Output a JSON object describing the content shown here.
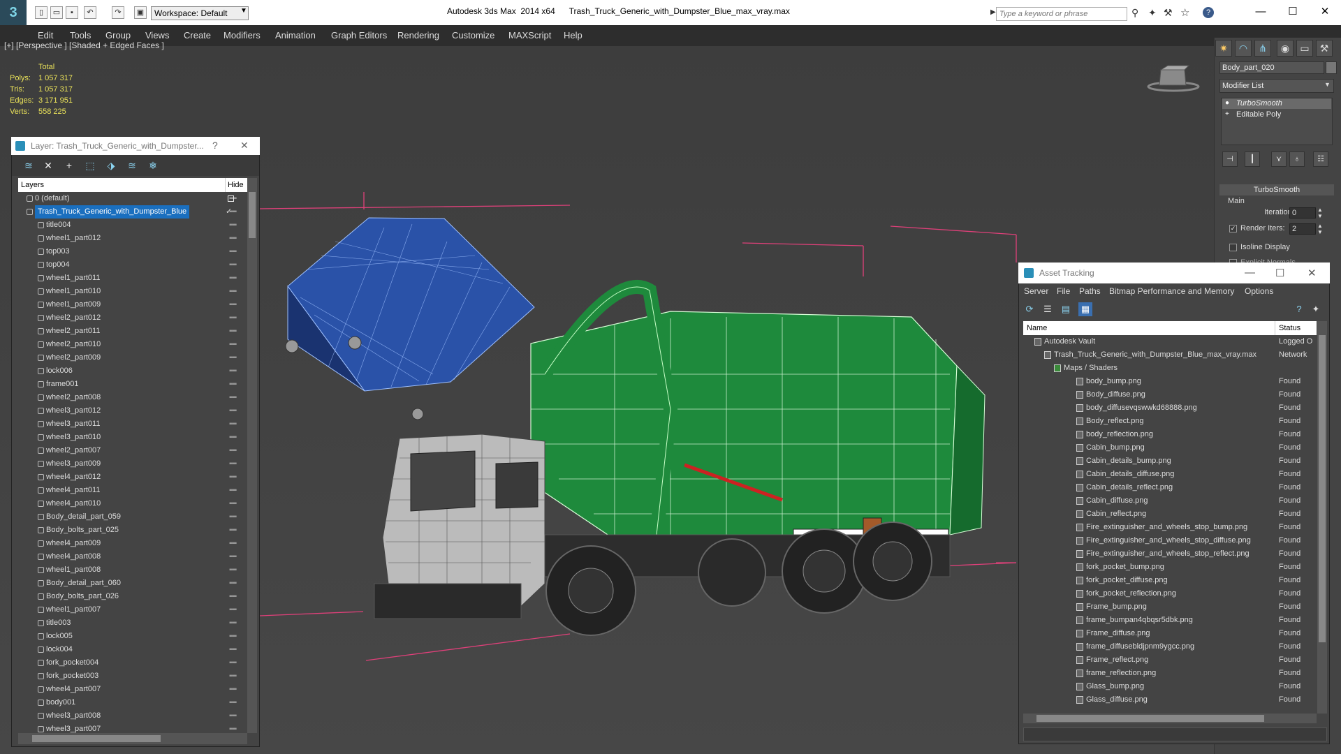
{
  "titlebar": {
    "app_title": "Autodesk 3ds Max  2014 x64",
    "file_name": "Trash_Truck_Generic_with_Dumpster_Blue_max_vray.max",
    "workspace": "Workspace: Default",
    "search_placeholder": "Type a keyword or phrase",
    "minimize": "—",
    "maximize": "☐",
    "close": "✕"
  },
  "menu": [
    "Edit",
    "Tools",
    "Group",
    "Views",
    "Create",
    "Modifiers",
    "Animation",
    "Graph Editors",
    "Rendering",
    "Customize",
    "MAXScript",
    "Help"
  ],
  "viewport": {
    "label": "[+] [Perspective ] [Shaded + Edged Faces ]",
    "stats": {
      "header": "Total",
      "rows": [
        {
          "label": "Polys:",
          "value": "1 057 317"
        },
        {
          "label": "Tris:",
          "value": "1 057 317"
        },
        {
          "label": "Edges:",
          "value": "3 171 951"
        },
        {
          "label": "Verts:",
          "value": "558 225"
        }
      ]
    }
  },
  "command_panel": {
    "object_name": "Body_part_020",
    "modifier_list": "Modifier List",
    "stack": [
      "TurboSmooth",
      "Editable Poly"
    ],
    "rollout_title": "TurboSmooth",
    "main_label": "Main",
    "iterations_label": "Iterations:",
    "iterations_value": "0",
    "render_iters_label": "Render Iters:",
    "render_iters_value": "2",
    "isoline_label": "Isoline Display",
    "explicit_label": "Explicit Normals"
  },
  "layer_explorer": {
    "title": "Layer: Trash_Truck_Generic_with_Dumpster...",
    "help": "?",
    "close": "✕",
    "col_layers": "Layers",
    "col_hide": "Hide",
    "rows": [
      {
        "name": "0 (default)",
        "level": 1,
        "selected": false
      },
      {
        "name": "Trash_Truck_Generic_with_Dumpster_Blue",
        "level": 1,
        "selected": true
      },
      {
        "name": "title004",
        "level": 2
      },
      {
        "name": "wheel1_part012",
        "level": 2
      },
      {
        "name": "top003",
        "level": 2
      },
      {
        "name": "top004",
        "level": 2
      },
      {
        "name": "wheel1_part011",
        "level": 2
      },
      {
        "name": "wheel1_part010",
        "level": 2
      },
      {
        "name": "wheel1_part009",
        "level": 2
      },
      {
        "name": "wheel2_part012",
        "level": 2
      },
      {
        "name": "wheel2_part011",
        "level": 2
      },
      {
        "name": "wheel2_part010",
        "level": 2
      },
      {
        "name": "wheel2_part009",
        "level": 2
      },
      {
        "name": "lock006",
        "level": 2
      },
      {
        "name": "frame001",
        "level": 2
      },
      {
        "name": "wheel2_part008",
        "level": 2
      },
      {
        "name": "wheel3_part012",
        "level": 2
      },
      {
        "name": "wheel3_part011",
        "level": 2
      },
      {
        "name": "wheel3_part010",
        "level": 2
      },
      {
        "name": "wheel2_part007",
        "level": 2
      },
      {
        "name": "wheel3_part009",
        "level": 2
      },
      {
        "name": "wheel4_part012",
        "level": 2
      },
      {
        "name": "wheel4_part011",
        "level": 2
      },
      {
        "name": "wheel4_part010",
        "level": 2
      },
      {
        "name": "Body_detail_part_059",
        "level": 2
      },
      {
        "name": "Body_bolts_part_025",
        "level": 2
      },
      {
        "name": "wheel4_part009",
        "level": 2
      },
      {
        "name": "wheel4_part008",
        "level": 2
      },
      {
        "name": "wheel1_part008",
        "level": 2
      },
      {
        "name": "Body_detail_part_060",
        "level": 2
      },
      {
        "name": "Body_bolts_part_026",
        "level": 2
      },
      {
        "name": "wheel1_part007",
        "level": 2
      },
      {
        "name": "title003",
        "level": 2
      },
      {
        "name": "lock005",
        "level": 2
      },
      {
        "name": "lock004",
        "level": 2
      },
      {
        "name": "fork_pocket004",
        "level": 2
      },
      {
        "name": "fork_pocket003",
        "level": 2
      },
      {
        "name": "wheel4_part007",
        "level": 2
      },
      {
        "name": "body001",
        "level": 2
      },
      {
        "name": "wheel3_part008",
        "level": 2
      },
      {
        "name": "wheel3_part007",
        "level": 2
      }
    ]
  },
  "asset_tracking": {
    "title": "Asset Tracking",
    "minimize": "—",
    "maximize": "☐",
    "close": "✕",
    "menu": [
      "Server",
      "File",
      "Paths",
      "Bitmap Performance and Memory",
      "Options"
    ],
    "col_name": "Name",
    "col_status": "Status",
    "rows": [
      {
        "name": "Autodesk Vault",
        "status": "Logged O",
        "level": 0
      },
      {
        "name": "Trash_Truck_Generic_with_Dumpster_Blue_max_vray.max",
        "status": "Network",
        "level": 1
      },
      {
        "name": "Maps / Shaders",
        "status": "",
        "level": 2
      },
      {
        "name": "body_bump.png",
        "status": "Found",
        "level": 3
      },
      {
        "name": "Body_diffuse.png",
        "status": "Found",
        "level": 3
      },
      {
        "name": "body_diffusevqswwkd68888.png",
        "status": "Found",
        "level": 3
      },
      {
        "name": "Body_reflect.png",
        "status": "Found",
        "level": 3
      },
      {
        "name": "body_reflection.png",
        "status": "Found",
        "level": 3
      },
      {
        "name": "Cabin_bump.png",
        "status": "Found",
        "level": 3
      },
      {
        "name": "Cabin_details_bump.png",
        "status": "Found",
        "level": 3
      },
      {
        "name": "Cabin_details_diffuse.png",
        "status": "Found",
        "level": 3
      },
      {
        "name": "Cabin_details_reflect.png",
        "status": "Found",
        "level": 3
      },
      {
        "name": "Cabin_diffuse.png",
        "status": "Found",
        "level": 3
      },
      {
        "name": "Cabin_reflect.png",
        "status": "Found",
        "level": 3
      },
      {
        "name": "Fire_extinguisher_and_wheels_stop_bump.png",
        "status": "Found",
        "level": 3
      },
      {
        "name": "Fire_extinguisher_and_wheels_stop_diffuse.png",
        "status": "Found",
        "level": 3
      },
      {
        "name": "Fire_extinguisher_and_wheels_stop_reflect.png",
        "status": "Found",
        "level": 3
      },
      {
        "name": "fork_pocket_bump.png",
        "status": "Found",
        "level": 3
      },
      {
        "name": "fork_pocket_diffuse.png",
        "status": "Found",
        "level": 3
      },
      {
        "name": "fork_pocket_reflection.png",
        "status": "Found",
        "level": 3
      },
      {
        "name": "Frame_bump.png",
        "status": "Found",
        "level": 3
      },
      {
        "name": "frame_bumpan4qbqsr5dbk.png",
        "status": "Found",
        "level": 3
      },
      {
        "name": "Frame_diffuse.png",
        "status": "Found",
        "level": 3
      },
      {
        "name": "frame_diffusebldjpnm9ygcc.png",
        "status": "Found",
        "level": 3
      },
      {
        "name": "Frame_reflect.png",
        "status": "Found",
        "level": 3
      },
      {
        "name": "frame_reflection.png",
        "status": "Found",
        "level": 3
      },
      {
        "name": "Glass_bump.png",
        "status": "Found",
        "level": 3
      },
      {
        "name": "Glass_diffuse.png",
        "status": "Found",
        "level": 3
      }
    ]
  },
  "colors": {
    "selection": "#1a6fbf",
    "stats_text": "#ece45a",
    "truck_green": "#1e8a3c",
    "dumpster_blue": "#2a52a8",
    "bbox_pink": "#e0407a"
  }
}
